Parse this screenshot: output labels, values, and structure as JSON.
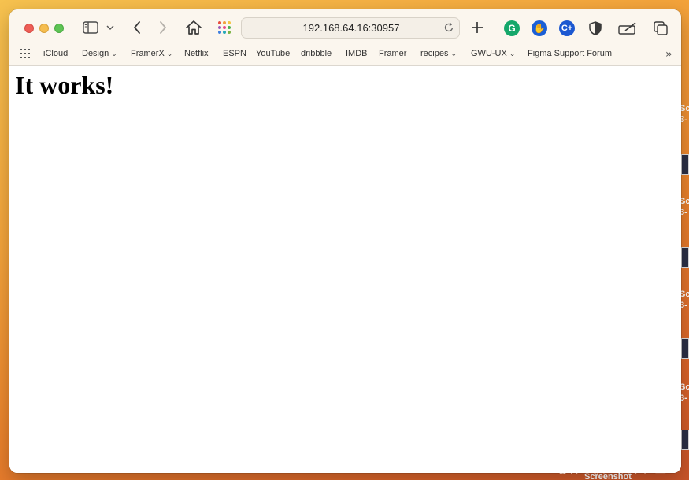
{
  "browser": {
    "address": "192.168.64.16:30957",
    "bookmarks": [
      {
        "label": "iCloud",
        "has_menu": false
      },
      {
        "label": "Design",
        "has_menu": true
      },
      {
        "label": "FramerX",
        "has_menu": true
      },
      {
        "label": "Netflix",
        "has_menu": false
      },
      {
        "label": "ESPN",
        "has_menu": false
      },
      {
        "label": "YouTube",
        "has_menu": false
      },
      {
        "label": "dribbble",
        "has_menu": false
      },
      {
        "label": "IMDB",
        "has_menu": false
      },
      {
        "label": "Framer",
        "has_menu": false
      },
      {
        "label": "recipes",
        "has_menu": true
      },
      {
        "label": "GWU-UX",
        "has_menu": true
      },
      {
        "label": "Figma Support Forum",
        "has_menu": false
      }
    ],
    "extensions": [
      {
        "name": "grammarly-icon",
        "glyph": "G",
        "color": "#15a76a"
      },
      {
        "name": "hand-block-icon",
        "glyph": "✋",
        "color": "#1a5fd6"
      },
      {
        "name": "c-plus-icon",
        "glyph": "C+",
        "color": "#1c58d1"
      }
    ]
  },
  "page": {
    "heading": "It works!"
  },
  "desktop": {
    "side_labels": [
      "Sc",
      "3-",
      "Sc",
      "3-",
      "Sc",
      "3-",
      "Sc",
      "3-"
    ],
    "bottom_label": "Screenshot",
    "watermark": "@稀土掘金技术社区"
  },
  "colors": {
    "close": "#ee5e56",
    "minimize": "#f5bd4f",
    "maximize": "#5ec454",
    "toolbar_bg": "#fbf6ee"
  }
}
